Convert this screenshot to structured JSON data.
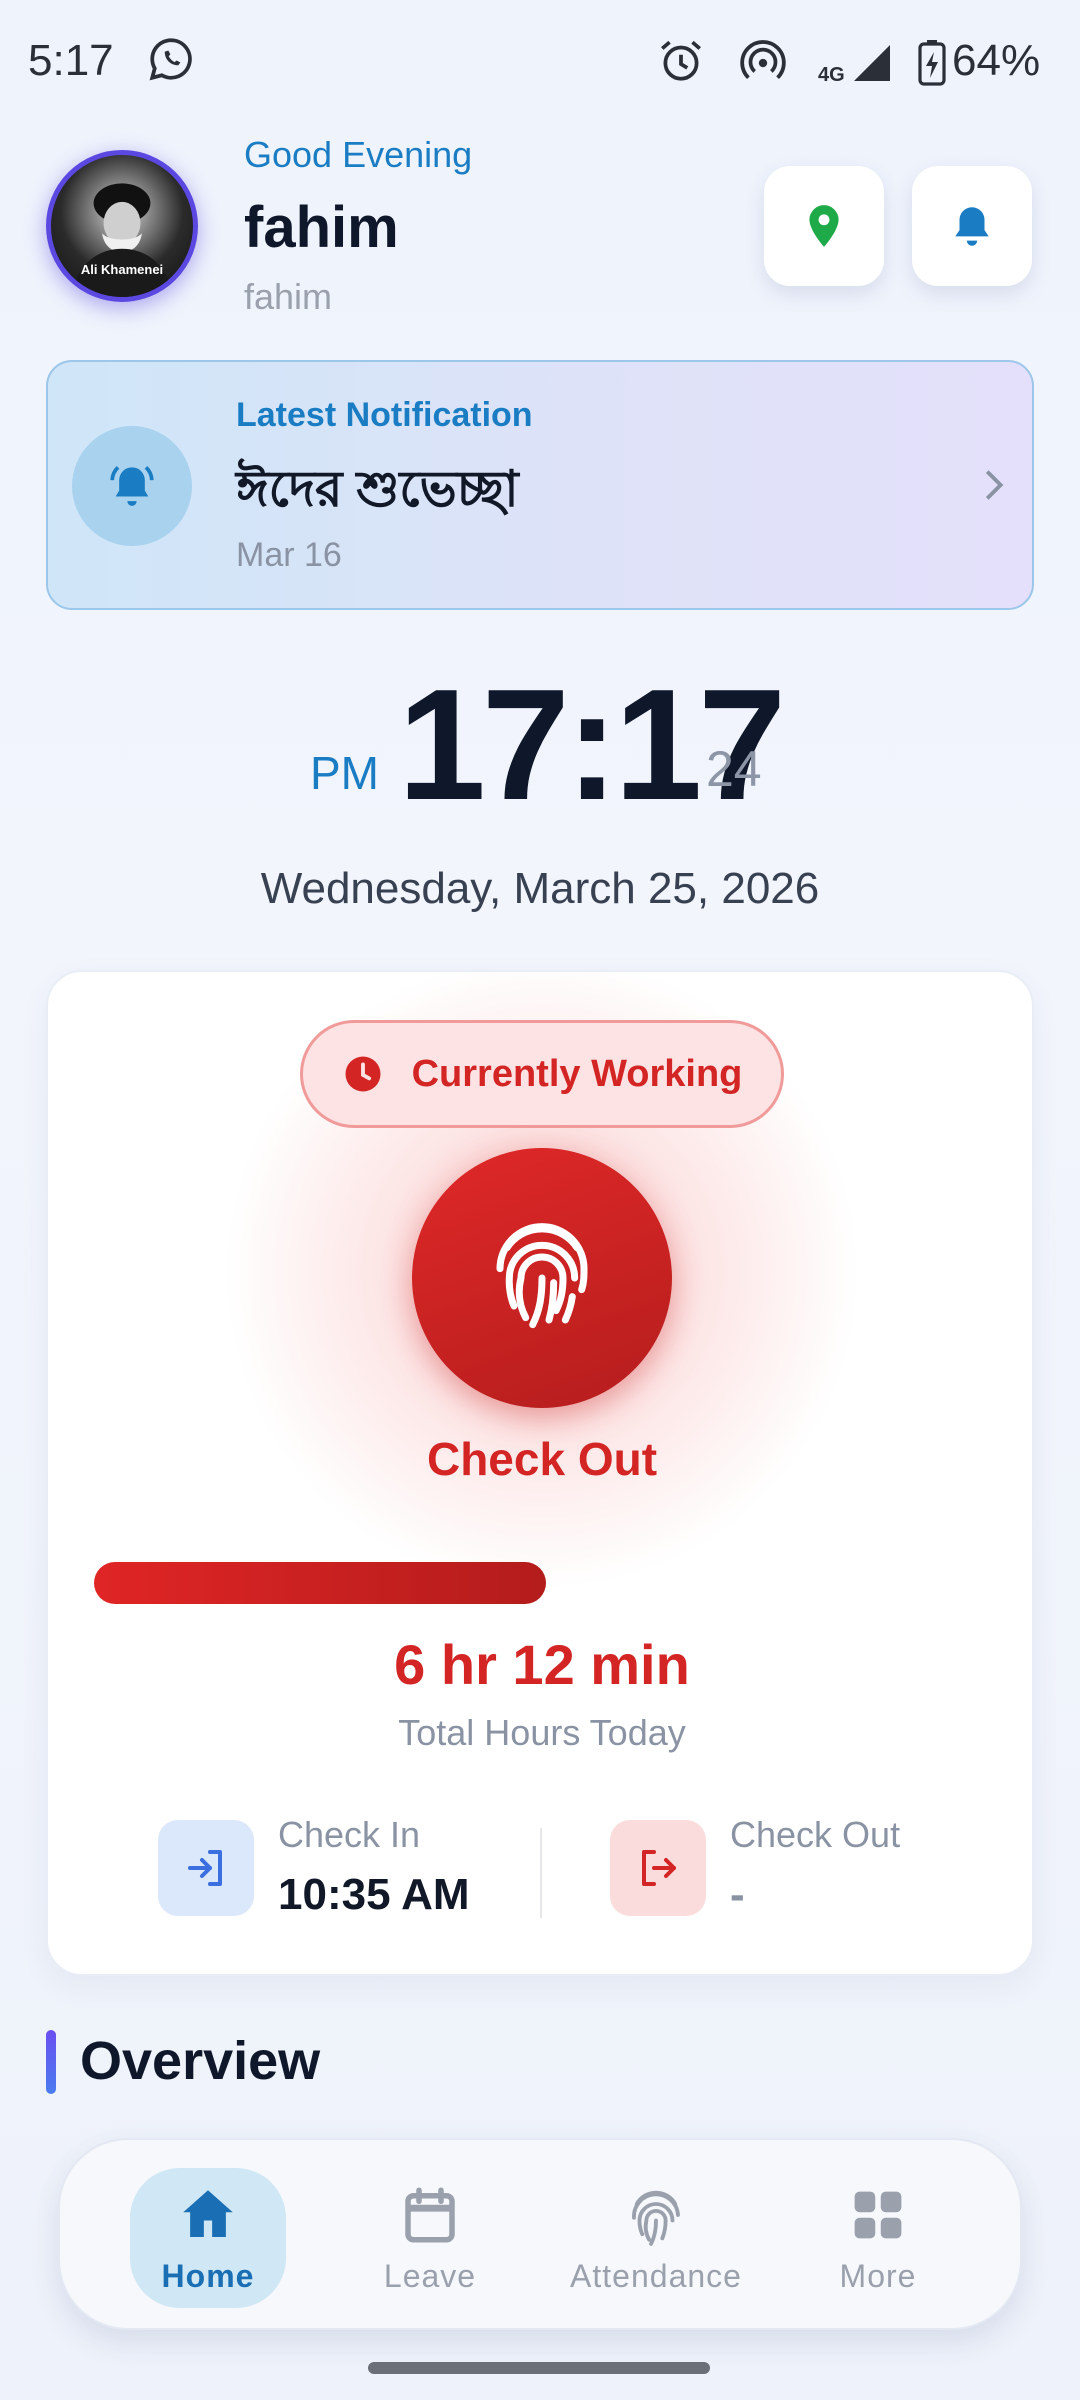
{
  "status_bar": {
    "time": "5:17",
    "network": "4G",
    "battery": "64%"
  },
  "header": {
    "greeting": "Good Evening",
    "name": "fahim",
    "username": "fahim",
    "avatar_caption": "Ali Khamenei"
  },
  "notification": {
    "label": "Latest Notification",
    "title": "ঈদের শুভেচ্ছা",
    "date": "Mar 16"
  },
  "clock": {
    "ampm": "PM",
    "time": "17:17",
    "seconds": "24",
    "date": "Wednesday, March 25, 2026"
  },
  "work_card": {
    "status": "Currently Working",
    "action_label": "Check Out",
    "progress_fraction": 0.505,
    "total_hours": "6 hr 12 min",
    "total_hours_label": "Total Hours Today",
    "check_in_label": "Check In",
    "check_in_value": "10:35 AM",
    "check_out_label": "Check Out",
    "check_out_value": "-"
  },
  "overview": {
    "title": "Overview"
  },
  "bottom_nav": {
    "items": [
      {
        "label": "Home",
        "icon": "home-icon",
        "active": true
      },
      {
        "label": "Leave",
        "icon": "calendar-icon",
        "active": false
      },
      {
        "label": "Attendance",
        "icon": "fingerprint-icon",
        "active": false
      },
      {
        "label": "More",
        "icon": "grid-icon",
        "active": false
      }
    ]
  },
  "colors": {
    "accent_blue": "#1a7dc4",
    "working_red": "#d42525",
    "location_green": "#1faa4a",
    "overview_accent": "#6a4ff0"
  }
}
